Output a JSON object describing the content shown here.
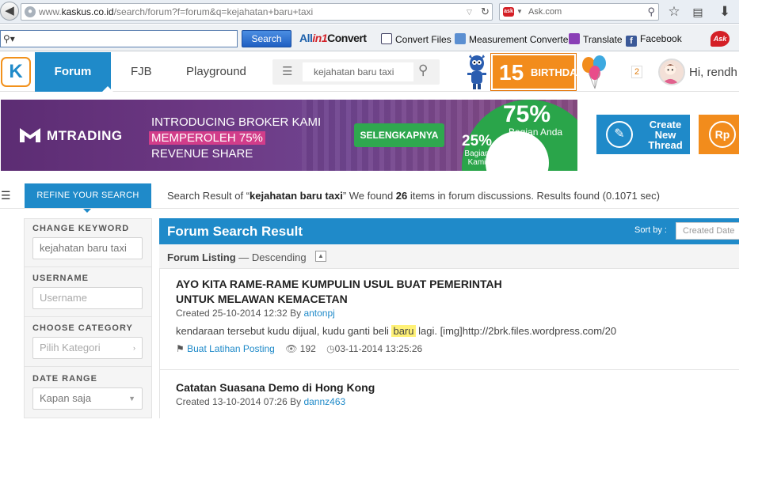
{
  "browser": {
    "url_prefix": "www.",
    "url_domain": "kaskus.co.id",
    "url_path": "/search/forum?f=forum&q=kejahatan+baru+taxi",
    "search_engine_text": "Ask.com"
  },
  "toolbar": {
    "search_button": "Search",
    "allin_logo": {
      "part1": "All",
      "part2": "in1",
      "part3": "Convert"
    },
    "items": [
      "Convert Files",
      "Measurement Converter",
      "Translate",
      "Facebook"
    ],
    "ask_logo": "Ask"
  },
  "site": {
    "nav": {
      "forum": "Forum",
      "fjb": "FJB",
      "playground": "Playground"
    },
    "search_value": "kejahatan baru taxi",
    "birthday": {
      "number": "15",
      "text": "BIRTHDAY"
    },
    "notification_count": "2",
    "greeting": "Hi, rendh"
  },
  "banner": {
    "brand": "MTRADING",
    "line1": "INTRODUCING BROKER KAMI",
    "line2": "MEMPEROLEH 75%",
    "line3": "REVENUE SHARE",
    "cta": "SELENGKAPNYA",
    "big_pct": "75%",
    "big_sub": "Bagian Anda",
    "small_pct": "25%",
    "small_sub_1": "Bagian",
    "small_sub_2": "Kami"
  },
  "actions": {
    "create_line1": "Create",
    "create_line2": "New",
    "create_line3": "Thread",
    "rp": "Rp"
  },
  "refine": {
    "tab_label": "REFINE YOUR SEARCH",
    "summary_prefix": "Search Result of “",
    "summary_query": "kejahatan baru taxi",
    "summary_mid": "” We found ",
    "summary_count": "26",
    "summary_suffix": " items in forum discussions. Results found (0.1071 sec)"
  },
  "sidebar": {
    "keyword_label": "CHANGE KEYWORD",
    "keyword_value": "kejahatan baru taxi",
    "username_label": "USERNAME",
    "username_placeholder": "Username",
    "category_label": "CHOOSE CATEGORY",
    "category_placeholder": "Pilih Kategori",
    "date_label": "DATE RANGE",
    "date_value": "Kapan saja"
  },
  "results": {
    "title": "Forum Search Result",
    "sort_label": "Sort by :",
    "sort_value": "Created Date",
    "listing_label": "Forum Listing",
    "listing_order": " — Descending",
    "items": [
      {
        "title_line1": "AYO KITA RAME-RAME KUMPULIN USUL BUAT PEMERINTAH",
        "title_line2": "UNTUK MELAWAN KEMACETAN",
        "created_prefix": "Created 25-10-2014 12:32 By ",
        "author": "antonpj",
        "snippet_before": "kendaraan tersebut kudu dijual, kudu ganti beli ",
        "snippet_highlight": "baru",
        "snippet_after": " lagi. [img]http://2brk.files.wordpress.com/20",
        "tag": "Buat Latihan Posting",
        "views": "192",
        "date": "03-11-2014 13:25:26"
      },
      {
        "title_line1": "Catatan Suasana Demo di Hong Kong",
        "created_prefix": "Created 13-10-2014 07:26 By ",
        "author": "dannz463"
      }
    ]
  },
  "colors": {
    "kaskus_blue": "#1f8ac9",
    "kaskus_orange": "#f28c1c",
    "highlight": "#fff176"
  }
}
